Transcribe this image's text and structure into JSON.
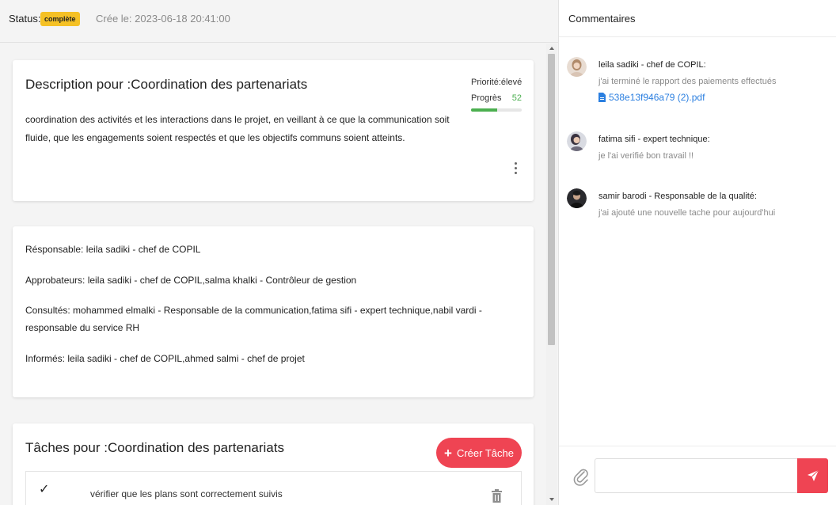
{
  "header": {
    "status_label": "Status:",
    "status_badge": "complète",
    "created": "Crée le: 2023-06-18 20:41:00"
  },
  "description": {
    "title": "Description pour :Coordination des partenariats",
    "priority": "Priorité:élevé",
    "progress_label": "Progrès",
    "progress_value": "52",
    "progress_percent": 52,
    "text": "coordination des activités et les interactions dans le projet, en veillant à ce que la communication soit fluide, que les engagements soient respectés et que les objectifs communs soient atteints.",
    "more_icon": "kebab-vertical-icon"
  },
  "roles": {
    "responsable": "Résponsable: leila sadiki - chef de COPIL",
    "approbateurs": "Approbateurs: leila sadiki - chef de COPIL,salma khalki - Contrôleur de gestion",
    "consultes": "Consultés: mohammed elmalki - Responsable de la communication,fatima sifi - expert technique,nabil vardi - responsable du service RH",
    "informes": "Informés: leila sadiki - chef de COPIL,ahmed salmi - chef de projet"
  },
  "tasks": {
    "title": "Tâches pour :Coordination des partenariats",
    "create_label": "Créer Tâche",
    "items": [
      {
        "check": "✓",
        "text": "vérifier que les plans sont correctement suivis"
      }
    ]
  },
  "comments": {
    "title": "Commentaires",
    "items": [
      {
        "author": "leila sadiki - chef de COPIL:",
        "text": "j'ai terminé le rapport des paiements effectués",
        "attachment": "538e13f946a79 (2).pdf"
      },
      {
        "author": "fatima sifi - expert technique:",
        "text": "je l'ai verifié bon travail !!"
      },
      {
        "author": "samir barodi - Responsable de la qualité:",
        "text": "j'ai ajouté une nouvelle tache pour aujourd'hui"
      }
    ],
    "input_placeholder": ""
  },
  "colors": {
    "accent": "#ef4453",
    "badge": "#f5c125",
    "progress": "#4caf50",
    "link": "#2b7fe0"
  }
}
